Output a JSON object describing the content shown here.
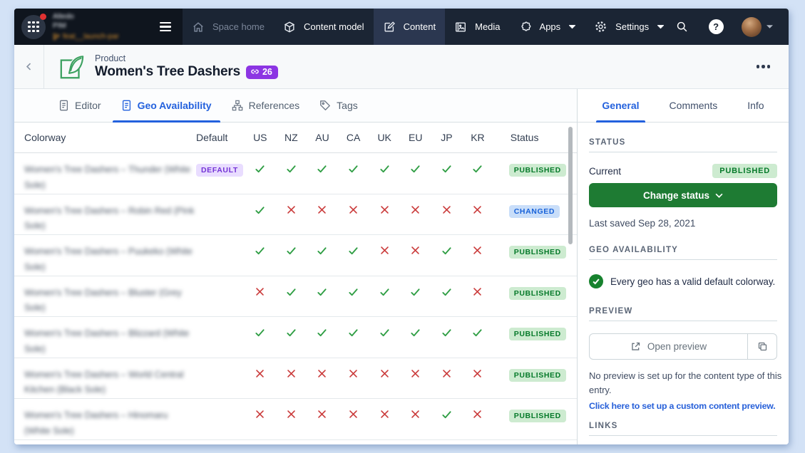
{
  "topbar": {
    "org": {
      "line1": "Altedo",
      "line2": "PIM",
      "branch": "feat__launch-par"
    },
    "items": [
      {
        "label": "Space home"
      },
      {
        "label": "Content model"
      },
      {
        "label": "Content"
      },
      {
        "label": "Media"
      },
      {
        "label": "Apps"
      },
      {
        "label": "Settings"
      }
    ]
  },
  "breadcrumb": {
    "type_label": "Product",
    "title": "Women's Tree Dashers",
    "links_count": "26"
  },
  "tabs": [
    {
      "label": "Editor"
    },
    {
      "label": "Geo Availability"
    },
    {
      "label": "References"
    },
    {
      "label": "Tags"
    }
  ],
  "table": {
    "columns": [
      "Colorway",
      "Default",
      "US",
      "NZ",
      "AU",
      "CA",
      "UK",
      "EU",
      "JP",
      "KR",
      "Status"
    ],
    "default_badge": "DEFAULT",
    "rows": [
      {
        "name": "Women's Tree Dashers – Thunder (White Sole)",
        "default": true,
        "marks": [
          "y",
          "y",
          "y",
          "y",
          "y",
          "y",
          "y",
          "y"
        ],
        "status": "PUBLISHED"
      },
      {
        "name": "Women's Tree Dashers – Robin Red (Pink Sole)",
        "default": false,
        "marks": [
          "y",
          "n",
          "n",
          "n",
          "n",
          "n",
          "n",
          "n"
        ],
        "status": "CHANGED"
      },
      {
        "name": "Women's Tree Dashers – Puukeko (White Sole)",
        "default": false,
        "marks": [
          "y",
          "y",
          "y",
          "y",
          "n",
          "n",
          "y",
          "n"
        ],
        "status": "PUBLISHED"
      },
      {
        "name": "Women's Tree Dashers – Bluster (Grey Sole)",
        "default": false,
        "marks": [
          "n",
          "y",
          "y",
          "y",
          "y",
          "y",
          "y",
          "n"
        ],
        "status": "PUBLISHED"
      },
      {
        "name": "Women's Tree Dashers – Blizzard (White Sole)",
        "default": false,
        "marks": [
          "y",
          "y",
          "y",
          "y",
          "y",
          "y",
          "y",
          "y"
        ],
        "status": "PUBLISHED"
      },
      {
        "name": "Women's Tree Dashers – World Central Kitchen (Black Sole)",
        "default": false,
        "marks": [
          "n",
          "n",
          "n",
          "n",
          "n",
          "n",
          "n",
          "n"
        ],
        "status": "PUBLISHED"
      },
      {
        "name": "Women's Tree Dashers – Hinomaru (White Sole)",
        "default": false,
        "marks": [
          "n",
          "n",
          "n",
          "n",
          "n",
          "n",
          "y",
          "n"
        ],
        "status": "PUBLISHED"
      }
    ]
  },
  "sidebar": {
    "tabs": [
      "General",
      "Comments",
      "Info"
    ],
    "status": {
      "heading": "STATUS",
      "current_label": "Current",
      "current_value": "PUBLISHED",
      "change_button": "Change status",
      "last_saved": "Last saved Sep 28, 2021"
    },
    "geo": {
      "heading": "GEO AVAILABILITY",
      "message": "Every geo has a valid default colorway."
    },
    "preview": {
      "heading": "PREVIEW",
      "open_button": "Open preview",
      "note": "No preview is set up for the content type of this entry.",
      "link": "Click here to set up a custom content preview."
    },
    "links": {
      "heading": "LINKS"
    }
  }
}
